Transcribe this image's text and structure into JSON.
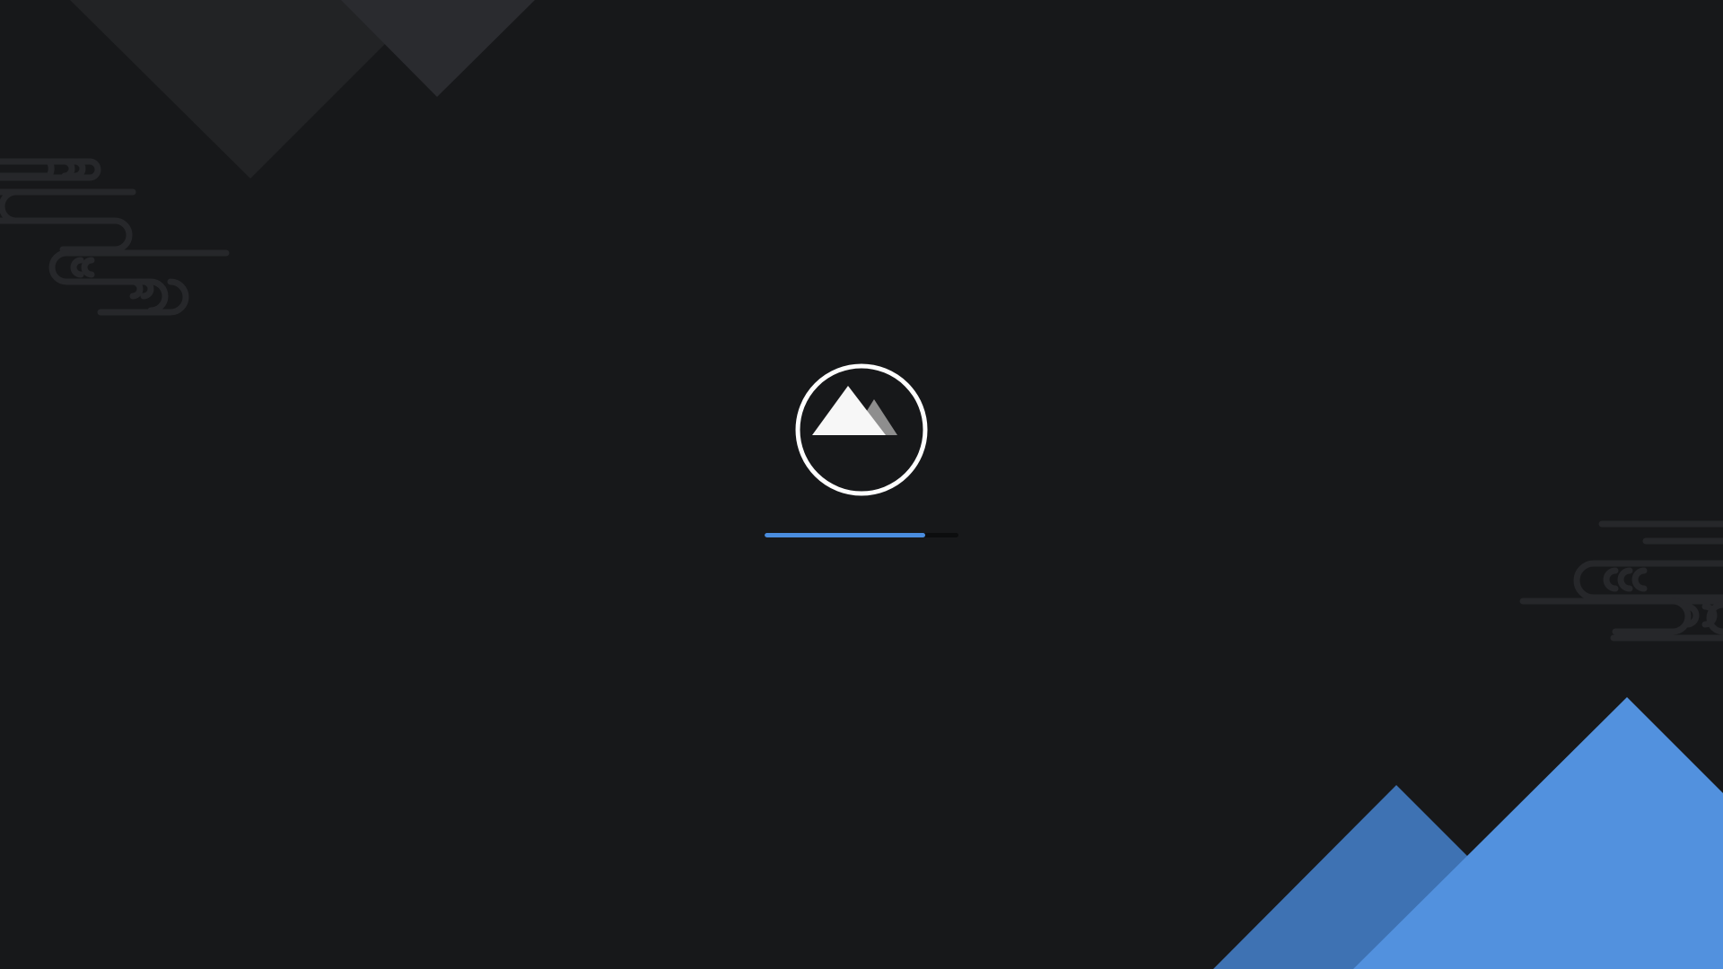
{
  "splash": {
    "logo_icon": "mountain-icon",
    "progress": 0.83
  },
  "colors": {
    "background": "#17181a",
    "accent": "#4a8ddf",
    "accent_dark": "#3e72b3",
    "accent_light": "#5291de",
    "logo_stroke": "#ffffff",
    "logo_peak_back": "#8e8e8e",
    "decor": "#242528"
  }
}
